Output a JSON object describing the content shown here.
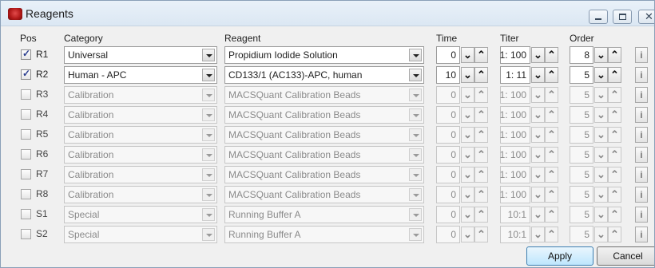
{
  "window": {
    "title": "Reagents"
  },
  "headers": {
    "pos": "Pos",
    "category": "Category",
    "reagent": "Reagent",
    "time": "Time",
    "titer": "Titer",
    "order": "Order"
  },
  "rows": [
    {
      "pos": "R1",
      "checked": true,
      "category": "Universal",
      "reagent": "Propidium Iodide Solution",
      "time": "0",
      "titer": "1: 100",
      "order": "8"
    },
    {
      "pos": "R2",
      "checked": true,
      "category": "Human - APC",
      "reagent": "CD133/1 (AC133)-APC, human",
      "time": "10",
      "titer": "1: 11",
      "order": "5"
    },
    {
      "pos": "R3",
      "checked": false,
      "category": "Calibration",
      "reagent": "MACSQuant Calibration Beads",
      "time": "0",
      "titer": "1: 100",
      "order": "5"
    },
    {
      "pos": "R4",
      "checked": false,
      "category": "Calibration",
      "reagent": "MACSQuant Calibration Beads",
      "time": "0",
      "titer": "1: 100",
      "order": "5"
    },
    {
      "pos": "R5",
      "checked": false,
      "category": "Calibration",
      "reagent": "MACSQuant Calibration Beads",
      "time": "0",
      "titer": "1: 100",
      "order": "5"
    },
    {
      "pos": "R6",
      "checked": false,
      "category": "Calibration",
      "reagent": "MACSQuant Calibration Beads",
      "time": "0",
      "titer": "1: 100",
      "order": "5"
    },
    {
      "pos": "R7",
      "checked": false,
      "category": "Calibration",
      "reagent": "MACSQuant Calibration Beads",
      "time": "0",
      "titer": "1: 100",
      "order": "5"
    },
    {
      "pos": "R8",
      "checked": false,
      "category": "Calibration",
      "reagent": "MACSQuant Calibration Beads",
      "time": "0",
      "titer": "1: 100",
      "order": "5"
    },
    {
      "pos": "S1",
      "checked": false,
      "category": "Special",
      "reagent": "Running Buffer A",
      "time": "0",
      "titer": "10:1",
      "order": "5"
    },
    {
      "pos": "S2",
      "checked": false,
      "category": "Special",
      "reagent": "Running Buffer A",
      "time": "0",
      "titer": "10:1",
      "order": "5"
    }
  ],
  "glyphs": {
    "down": "⌄",
    "up": "⌃",
    "info": "i",
    "check": "✓",
    "close": "✕"
  },
  "buttons": {
    "apply": "Apply",
    "cancel": "Cancel"
  },
  "colors": {
    "accent": "#3c7fb1",
    "app_icon": "#b21919"
  }
}
